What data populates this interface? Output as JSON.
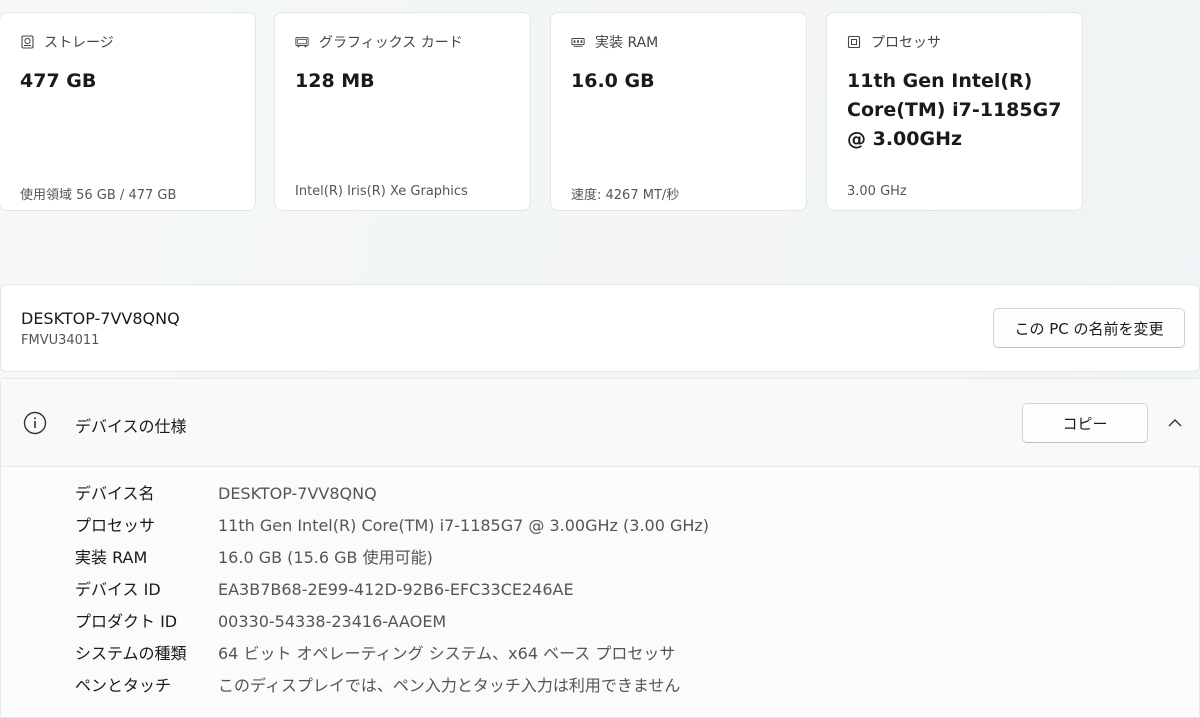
{
  "cards": [
    {
      "icon": "storage-icon",
      "label": "ストレージ",
      "value": "477 GB",
      "sub": "使用領域 56 GB / 477 GB"
    },
    {
      "icon": "graphics-card-icon",
      "label": "グラフィックス カード",
      "value": "128 MB",
      "sub": "Intel(R) Iris(R) Xe Graphics"
    },
    {
      "icon": "ram-icon",
      "label": "実装 RAM",
      "value": "16.0 GB",
      "sub": "速度: 4267 MT/秒"
    },
    {
      "icon": "processor-icon",
      "label": "プロセッサ",
      "value": "11th Gen Intel(R) Core(TM) i7-1185G7 @ 3.00GHz",
      "sub": "3.00 GHz"
    }
  ],
  "pc": {
    "name": "DESKTOP-7VV8QNQ",
    "model": "FMVU34011",
    "rename_label": "この PC の名前を変更"
  },
  "specs": {
    "title": "デバイスの仕様",
    "copy_label": "コピー",
    "rows": [
      {
        "key": "デバイス名",
        "value": "DESKTOP-7VV8QNQ"
      },
      {
        "key": "プロセッサ",
        "value": "11th Gen Intel(R) Core(TM) i7-1185G7 @ 3.00GHz (3.00 GHz)"
      },
      {
        "key": "実装 RAM",
        "value": "16.0 GB (15.6 GB 使用可能)"
      },
      {
        "key": "デバイス ID",
        "value": "EA3B7B68-2E99-412D-92B6-EFC33CE246AE"
      },
      {
        "key": "プロダクト ID",
        "value": "00330-54338-23416-AAOEM"
      },
      {
        "key": "システムの種類",
        "value": "64 ビット オペレーティング システム、x64 ベース プロセッサ"
      },
      {
        "key": "ペンとタッチ",
        "value": "このディスプレイでは、ペン入力とタッチ入力は利用できません"
      }
    ]
  }
}
